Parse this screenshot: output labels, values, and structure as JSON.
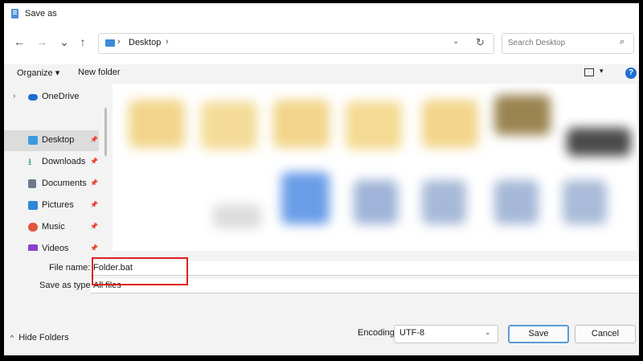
{
  "window": {
    "title": "Save as"
  },
  "nav": {
    "back": "←",
    "forward": "→",
    "up": "↑",
    "address": {
      "sep": "›",
      "folder": "Desktop",
      "dropdown": "⌄",
      "refresh": "↻"
    },
    "search": {
      "placeholder": "Search Desktop",
      "icon": "search-icon"
    }
  },
  "commands": {
    "organize": "Organize ▾",
    "new_folder": "New folder",
    "view_dd": "▾",
    "help": "?"
  },
  "sidebar": {
    "items": [
      {
        "label": "OneDrive",
        "chev": "›",
        "icon": "cloud-icon",
        "color": "#1e6fd0"
      },
      {
        "label": "Desktop",
        "pin": "📌",
        "icon": "desktop-icon",
        "color": "#3b9be0",
        "selected": true
      },
      {
        "label": "Downloads",
        "pin": "📌",
        "icon": "download-icon",
        "color": "#1c9c5a"
      },
      {
        "label": "Documents",
        "pin": "📌",
        "icon": "documents-icon",
        "color": "#6c7a89"
      },
      {
        "label": "Pictures",
        "pin": "📌",
        "icon": "pictures-icon",
        "color": "#2f86d6"
      },
      {
        "label": "Music",
        "pin": "📌",
        "icon": "music-icon",
        "color": "#e0553b"
      },
      {
        "label": "Videos",
        "pin": "📌",
        "icon": "videos-icon",
        "color": "#8a3fd0"
      }
    ]
  },
  "form": {
    "file_name_label": "File name:",
    "file_name_value": "Folder.bat",
    "save_type_label": "Save as type:",
    "save_type_value": "All files"
  },
  "footer": {
    "hide_folders": "Hide Folders",
    "hide_chev": "^",
    "encoding_label": "Encoding:",
    "encoding_value": "UTF-8",
    "encoding_dd": "⌄",
    "save_label": "Save",
    "cancel_label": "Cancel"
  },
  "colors": {
    "highlight": "#e02020",
    "accent": "#1e6fd0"
  }
}
